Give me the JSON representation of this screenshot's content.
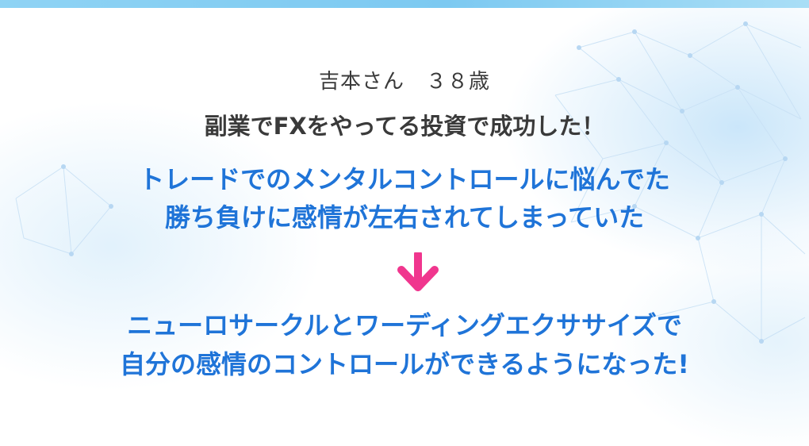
{
  "profile": {
    "name_age": "吉本さん　３８歳",
    "headline": "副業でFXをやってる投資で成功した！"
  },
  "before": {
    "line1": "トレードでのメンタルコントロールに悩んでた",
    "line2": "勝ち負けに感情が左右されてしまっていた"
  },
  "after": {
    "line1": "ニューロサークルとワーディングエクササイズで",
    "line2": "自分の感情のコントロールができるようになった!"
  },
  "colors": {
    "accent_blue": "#1f74d8",
    "arrow_pink": "#f0368e",
    "text_dark": "#3a3a3a"
  },
  "icons": {
    "arrow": "down-arrow-icon",
    "background": "network-mesh-decoration"
  }
}
